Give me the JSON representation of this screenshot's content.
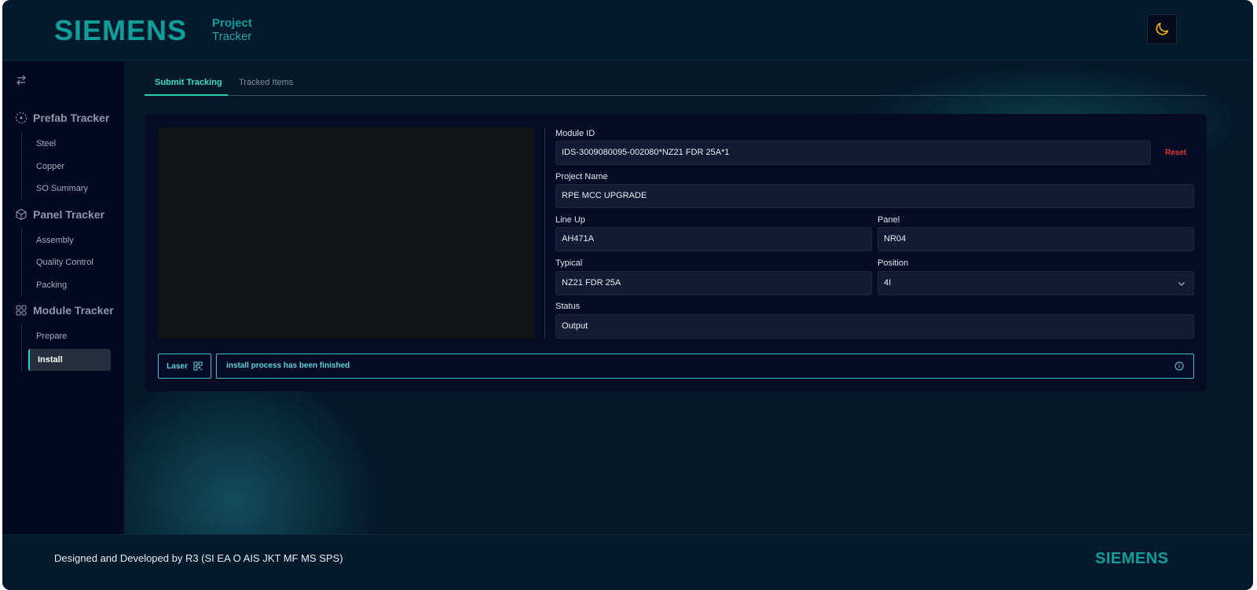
{
  "header": {
    "brand": "SIEMENS",
    "subtitle_line1": "Project",
    "subtitle_line2": "Tracker",
    "theme_icon": "moon-icon"
  },
  "sidebar": {
    "collapse_icon": "swap-arrows-icon",
    "sections": [
      {
        "label": "Prefab Tracker",
        "icon": "dashed-circle-icon",
        "items": [
          "Steel",
          "Copper",
          "SO Summary"
        ]
      },
      {
        "label": "Panel Tracker",
        "icon": "cube-icon",
        "items": [
          "Assembly",
          "Quality Control",
          "Packing"
        ]
      },
      {
        "label": "Module Tracker",
        "icon": "modules-icon",
        "items": [
          "Prepare",
          "Install"
        ]
      }
    ],
    "active_item": "Install"
  },
  "tabs": {
    "submit": "Submit Tracking",
    "tracked": "Tracked Items",
    "active": "Submit Tracking"
  },
  "form": {
    "module_id_label": "Module ID",
    "module_id_value": "IDS-3009080095-002080*NZ21 FDR 25A*1",
    "reset_label": "Reset",
    "project_name_label": "Project Name",
    "project_name_value": "RPE MCC UPGRADE",
    "line_up_label": "Line Up",
    "line_up_value": "AH471A",
    "panel_label": "Panel",
    "panel_value": "NR04",
    "typical_label": "Typical",
    "typical_value": "NZ21 FDR 25A",
    "position_label": "Position",
    "position_value": "4I",
    "status_label": "Status",
    "status_value": "Output"
  },
  "actions": {
    "laser_label": "Laser",
    "message": "install process has been finished"
  },
  "footer": {
    "credit": "Designed and Developed by R3 (SI EA O AIS JKT MF MS SPS)",
    "logo": "SIEMENS"
  },
  "colors": {
    "accent": "#0f9e9a",
    "active_tab": "#3ddfc0",
    "reset": "#e13a3a",
    "message": "#5fd4dd"
  }
}
